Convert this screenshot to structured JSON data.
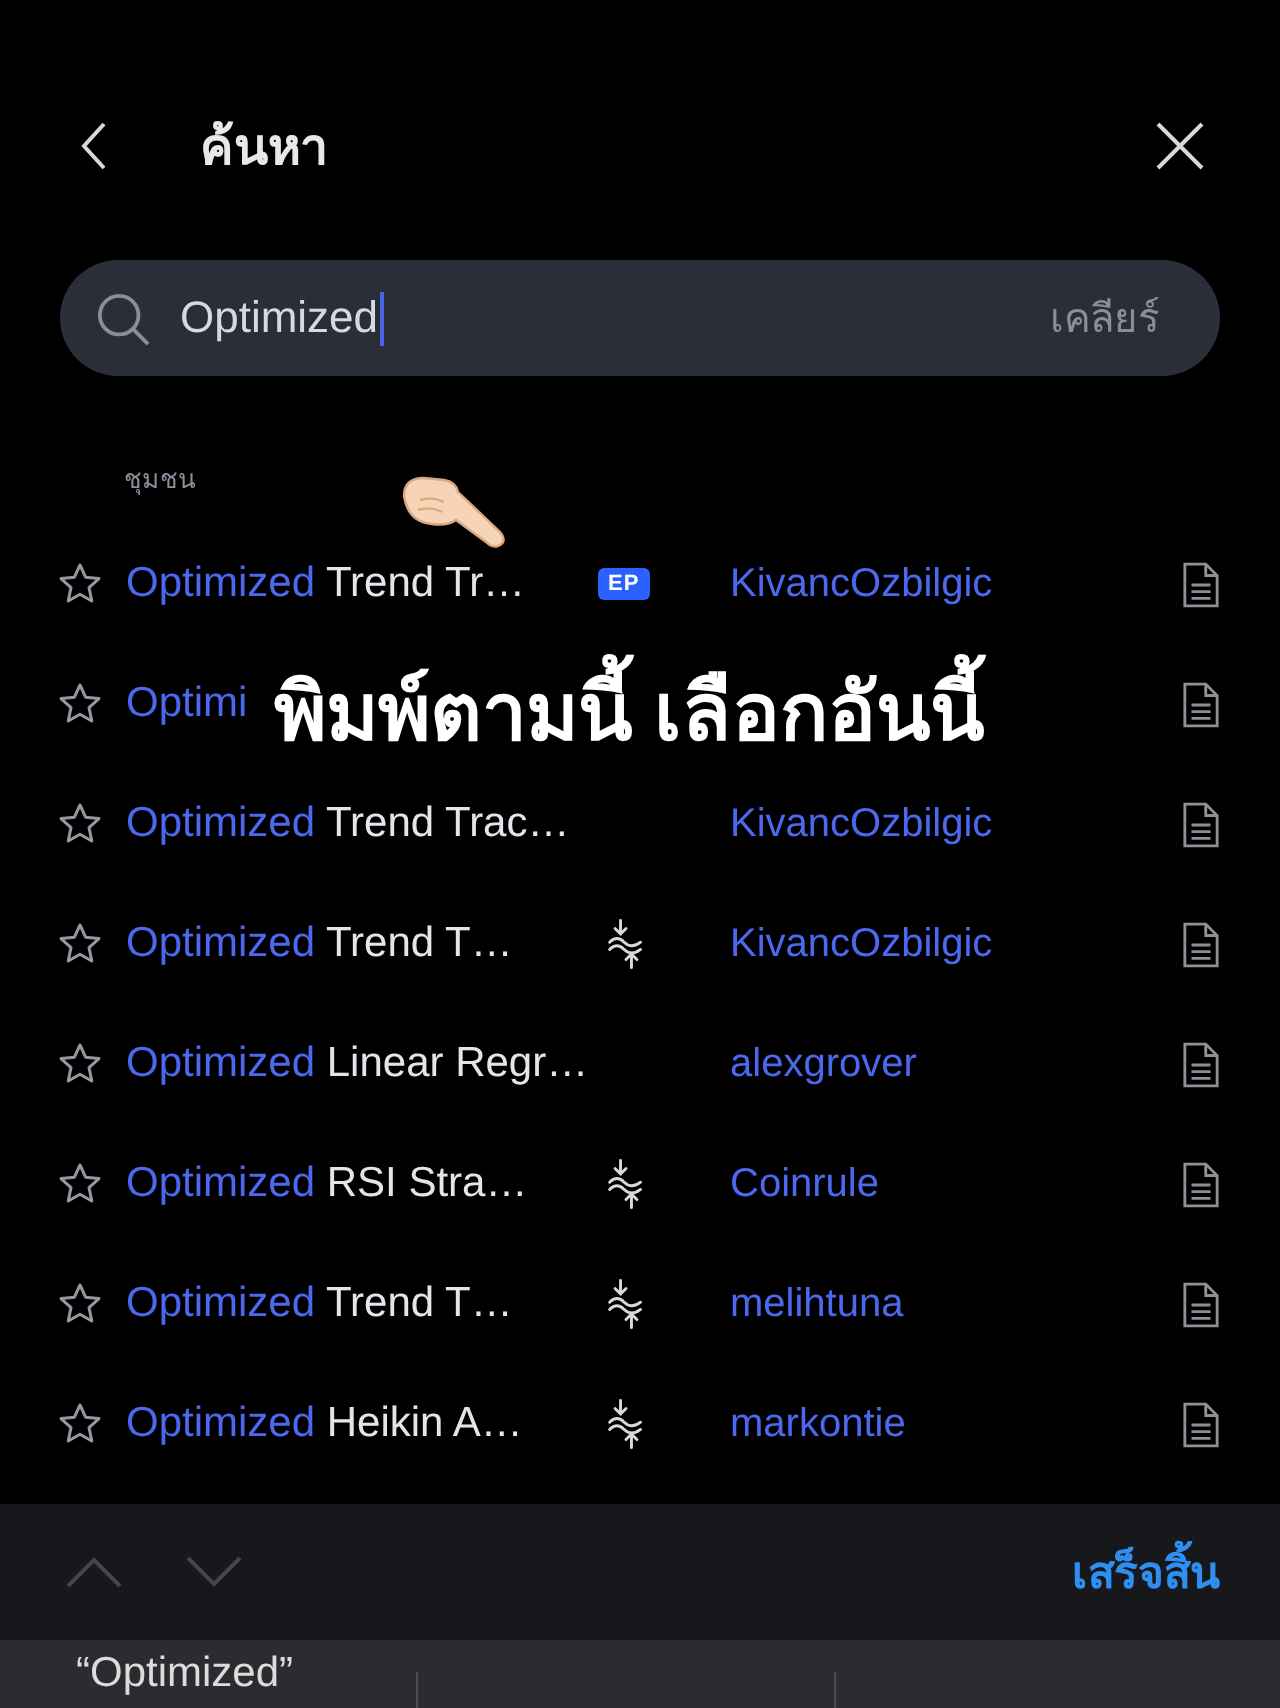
{
  "header": {
    "title": "ค้นหา"
  },
  "search": {
    "value": "Optimized",
    "clear_label": "เคลียร์"
  },
  "section": {
    "title": "ชุมชน"
  },
  "results": [
    {
      "match": "Optimized",
      "rest": "Trend Tr…",
      "badge": "EP",
      "strategy": false,
      "author": "KivancOzbilgic",
      "starred": false
    },
    {
      "match": "Optimi",
      "strategy": false,
      "starred": false
    },
    {
      "match": "Optimized",
      "rest": "Trend Trac…",
      "strategy": false,
      "author": "KivancOzbilgic",
      "starred": false
    },
    {
      "match": "Optimized",
      "rest": "Trend T…",
      "strategy": true,
      "author": "KivancOzbilgic",
      "starred": false
    },
    {
      "match": "Optimized",
      "rest": "Linear Regr…",
      "strategy": false,
      "author": "alexgrover",
      "starred": false
    },
    {
      "match": "Optimized",
      "rest": "RSI Stra…",
      "strategy": true,
      "author": "Coinrule",
      "starred": false
    },
    {
      "match": "Optimized",
      "rest": "Trend T…",
      "strategy": true,
      "author": "melihtuna",
      "starred": false
    },
    {
      "match": "Optimized",
      "rest": "Heikin A…",
      "strategy": true,
      "author": "markontie",
      "starred": false
    }
  ],
  "overlay": {
    "caption": "พิมพ์ตามนี้ เลือกอันนี้"
  },
  "toolbar": {
    "done_label": "เสร็จสิ้น"
  },
  "suggestions": [
    "“Optimized”"
  ]
}
